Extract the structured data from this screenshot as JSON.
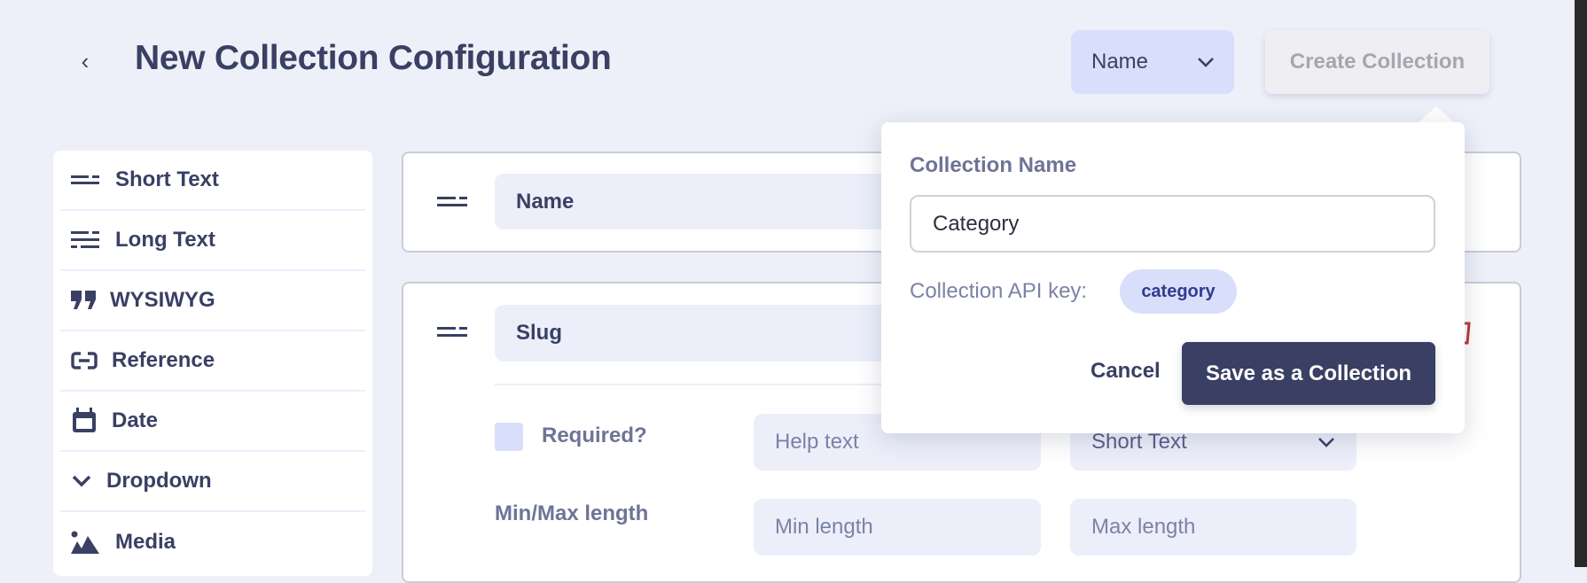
{
  "header": {
    "title": "New Collection Configuration",
    "back_icon": "chevron-left-icon",
    "name_select": "Name",
    "create_button": "Create Collection"
  },
  "sidebar": {
    "items": [
      {
        "label": "Short Text",
        "icon": "short-text-icon"
      },
      {
        "label": "Long Text",
        "icon": "long-text-icon"
      },
      {
        "label": "WYSIWYG",
        "icon": "quote-icon"
      },
      {
        "label": "Reference",
        "icon": "link-icon"
      },
      {
        "label": "Date",
        "icon": "calendar-icon"
      },
      {
        "label": "Dropdown",
        "icon": "chevron-down-icon"
      },
      {
        "label": "Media",
        "icon": "image-icon"
      }
    ]
  },
  "fields": [
    {
      "name": "Name"
    },
    {
      "name": "Slug",
      "required_label": "Required?",
      "help_placeholder": "Help text",
      "type": "Short Text",
      "minmax_label": "Min/Max length",
      "min_placeholder": "Min length",
      "max_placeholder": "Max length"
    }
  ],
  "popover": {
    "label": "Collection Name",
    "value": "Category",
    "api_key_label": "Collection API key:",
    "api_key": "category",
    "cancel": "Cancel",
    "save": "Save as a Collection"
  },
  "colors": {
    "primary": "#3a4063",
    "accent_bg": "#d9defa",
    "danger": "#c0353a"
  }
}
